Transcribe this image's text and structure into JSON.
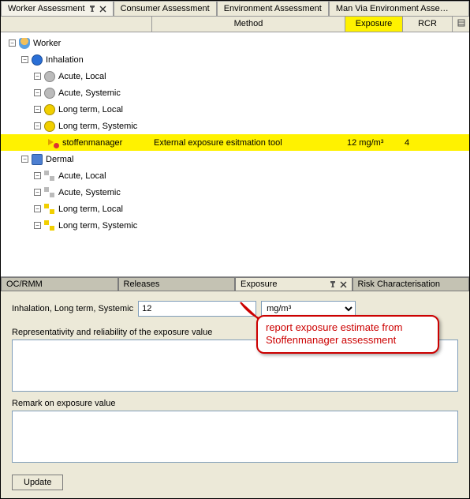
{
  "topTabs": {
    "worker": "Worker Assessment",
    "consumer": "Consumer Assessment",
    "environment": "Environment Assessment",
    "manvia": "Man Via Environment Asse…"
  },
  "columns": {
    "method": "Method",
    "exposure": "Exposure",
    "rcr": "RCR"
  },
  "tree": {
    "worker": "Worker",
    "inhalation": "Inhalation",
    "inh": {
      "acuteLocal": "Acute, Local",
      "acuteSystemic": "Acute, Systemic",
      "longLocal": "Long term, Local",
      "longSystemic": "Long term, Systemic"
    },
    "leaf": {
      "name": "stoffenmanager",
      "method": "External exposure esitmation tool",
      "exposure": "12 mg/m³",
      "rcr": "4"
    },
    "dermal": "Dermal",
    "derm": {
      "acuteLocal": "Acute, Local",
      "acuteSystemic": "Acute, Systemic",
      "longLocal": "Long term, Local",
      "longSystemic": "Long term, Systemic"
    }
  },
  "subTabs": {
    "ocrmm": "OC/RMM",
    "releases": "Releases",
    "exposure": "Exposure",
    "risk": "Risk Characterisation"
  },
  "form": {
    "pathLabel": "Inhalation, Long term, Systemic",
    "value": "12",
    "unit": "mg/m³",
    "repLabel": "Representativity and reliability of the exposure value",
    "repValue": "",
    "remarkLabel": "Remark on exposure value",
    "remarkValue": "",
    "updateLabel": "Update"
  },
  "callout": "report exposure estimate from Stoffenmanager assessment"
}
